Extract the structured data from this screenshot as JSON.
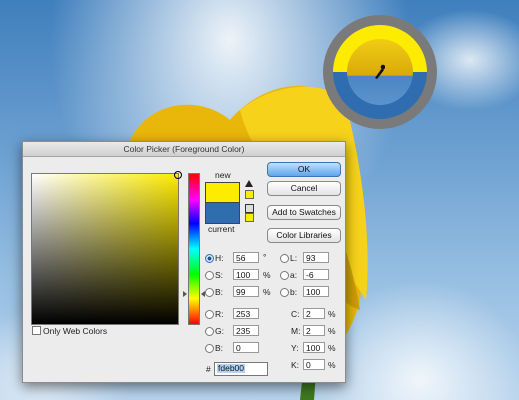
{
  "dialog": {
    "title": "Color Picker (Foreground Color)",
    "new_label": "new",
    "current_label": "current",
    "only_web_colors_label": "Only Web Colors",
    "buttons": {
      "ok": "OK",
      "cancel": "Cancel",
      "add_to_swatches": "Add to Swatches",
      "color_libraries": "Color Libraries"
    },
    "hsb": {
      "h": {
        "label": "H:",
        "value": "56",
        "unit": "°"
      },
      "s": {
        "label": "S:",
        "value": "100",
        "unit": "%"
      },
      "b": {
        "label": "B:",
        "value": "99",
        "unit": "%"
      }
    },
    "rgb": {
      "r": {
        "label": "R:",
        "value": "253"
      },
      "g": {
        "label": "G:",
        "value": "235"
      },
      "b": {
        "label": "B:",
        "value": "0"
      }
    },
    "lab": {
      "l": {
        "label": "L:",
        "value": "93"
      },
      "a": {
        "label": "a:",
        "value": "-6"
      },
      "b": {
        "label": "b:",
        "value": "100"
      }
    },
    "cmyk": {
      "c": {
        "label": "C:",
        "value": "2",
        "unit": "%"
      },
      "m": {
        "label": "M:",
        "value": "2",
        "unit": "%"
      },
      "y": {
        "label": "Y:",
        "value": "100",
        "unit": "%"
      },
      "k": {
        "label": "K:",
        "value": "0",
        "unit": "%"
      }
    },
    "hex": {
      "label": "#",
      "value": "fdeb00"
    }
  },
  "colors": {
    "new_color": "#fdeb00",
    "current_color": "#2f6db0",
    "ok_button_accent": "#5fa6ea"
  },
  "icons": [
    "out-of-gamut-warning-icon",
    "web-safe-cube-icon",
    "eyedropper-cursor-icon"
  ]
}
